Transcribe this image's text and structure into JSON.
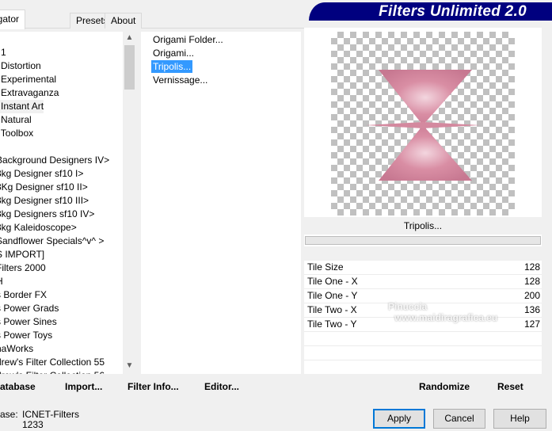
{
  "tabs": [
    {
      "label": "igator"
    },
    {
      "label": "Presets"
    },
    {
      "label": "About"
    }
  ],
  "banner": "Filters Unlimited 2.0",
  "categories": [
    "l 1",
    "l Distortion",
    "l Experimental",
    "l Extravaganza",
    "l Instant Art",
    "l Natural",
    "l Toolbox",
    "l",
    "Background Designers IV>",
    "3kg Designer sf10 I>",
    "3Kg Designer sf10 II>",
    "3kg Designer sf10 III>",
    "3kg Designers sf10 IV>",
    "3kg Kaleidoscope>",
    "Sandflower Specials^v^ >",
    "S IMPORT]",
    "Filters 2000",
    "H",
    "s Border FX",
    "s Power Grads",
    "s Power Sines",
    "s Power Toys",
    "naWorks",
    "drew's Filter Collection 55",
    "drew's Filter Collection 56"
  ],
  "selected_category": "l Instant Art",
  "filters": [
    "Origami Folder...",
    "Origami...",
    "Tripolis...",
    "Vernissage..."
  ],
  "selected_filter": "Tripolis...",
  "filter_name": "Tripolis...",
  "params": [
    {
      "label": "Tile Size",
      "value": "128"
    },
    {
      "label": "Tile One - X",
      "value": "128"
    },
    {
      "label": "Tile One - Y",
      "value": "200"
    },
    {
      "label": "Tile Two - X",
      "value": "136"
    },
    {
      "label": "Tile Two - Y",
      "value": "127"
    }
  ],
  "left_buttons": {
    "database": "atabase",
    "import": "Import...",
    "filter_info": "Filter Info...",
    "editor": "Editor..."
  },
  "right_buttons": {
    "randomize": "Randomize",
    "reset": "Reset"
  },
  "status": {
    "label": "ase:",
    "database": "ICNET-Filters",
    "count": "1233"
  },
  "dialog_buttons": {
    "apply": "Apply",
    "cancel": "Cancel",
    "help": "Help"
  },
  "watermark": {
    "name": "Pinuccia",
    "url": "www.maidiragrafica.eu"
  },
  "colors": {
    "selection": "#3399ff",
    "banner": "#00007f",
    "preview_shape": "#d896a8"
  }
}
